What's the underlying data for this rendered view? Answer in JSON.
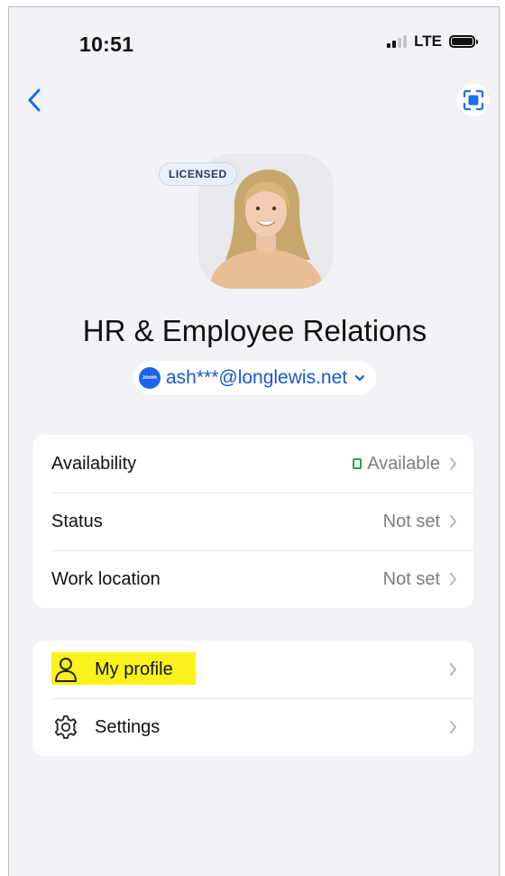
{
  "status_bar": {
    "time": "10:51",
    "network": "LTE"
  },
  "nav": {
    "back_icon": "chevron-left-icon",
    "scan_icon": "scan-icon"
  },
  "profile": {
    "badge": "LICENSED",
    "name": "HR & Employee Relations",
    "account_logo_text": "zoom",
    "account_email": "ash***@longlewis.net"
  },
  "presence_card": {
    "rows": [
      {
        "label": "Availability",
        "value": "Available",
        "status_color": "#19a84a"
      },
      {
        "label": "Status",
        "value": "Not set"
      },
      {
        "label": "Work location",
        "value": "Not set"
      }
    ]
  },
  "menu_card": {
    "rows": [
      {
        "label": "My profile",
        "icon": "person-icon",
        "highlight_color": "#fbf21b"
      },
      {
        "label": "Settings",
        "icon": "gear-icon"
      }
    ]
  },
  "colors": {
    "background": "#f1f3f6",
    "accent": "#1a56d6",
    "zoom_blue": "#1e63f0"
  }
}
